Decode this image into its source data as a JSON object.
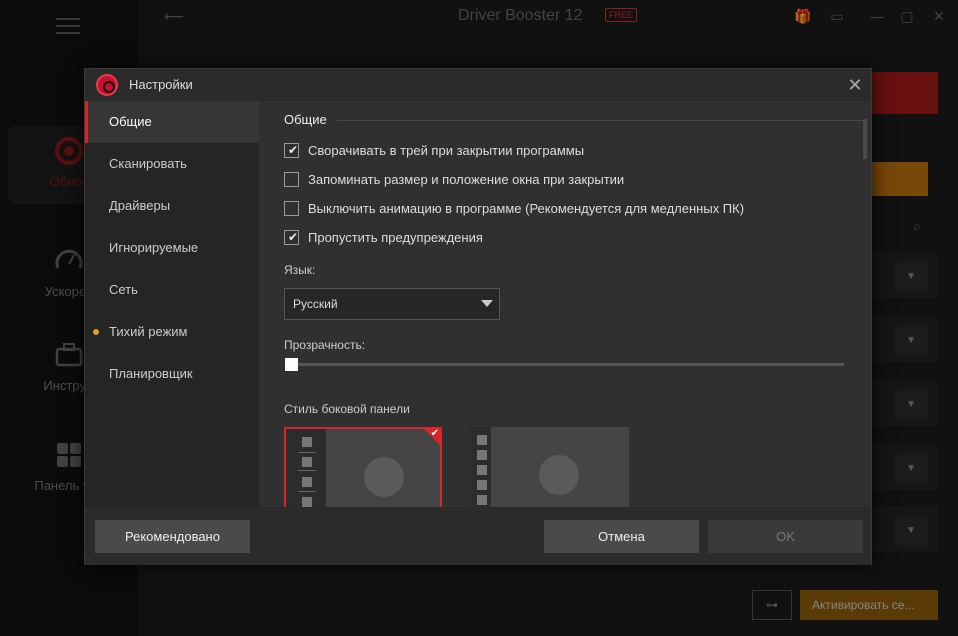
{
  "app": {
    "title": "Driver Booster 12",
    "badge": "FREE",
    "sidebar": [
      {
        "label": "Обнов",
        "icon": "update-icon"
      },
      {
        "label": "Ускорен",
        "icon": "speedometer-icon"
      },
      {
        "label": "Инструм",
        "icon": "toolbox-icon"
      },
      {
        "label": "Панель упр",
        "icon": "grid-icon"
      }
    ],
    "activate_label": "Активировать се...",
    "accent": "#d6262b",
    "warning": "#e5a023"
  },
  "dialog": {
    "title": "Настройки",
    "nav": [
      {
        "label": "Общие",
        "active": true
      },
      {
        "label": "Сканировать"
      },
      {
        "label": "Драйверы"
      },
      {
        "label": "Игнорируемые"
      },
      {
        "label": "Сеть"
      },
      {
        "label": "Тихий режим",
        "dot": true
      },
      {
        "label": "Планировщик"
      }
    ],
    "section_title": "Общие",
    "options": [
      {
        "label": "Сворачивать в трей при закрытии программы",
        "checked": true
      },
      {
        "label": "Запоминать размер и положение окна при закрытии",
        "checked": false
      },
      {
        "label": "Выключить анимацию в программе (Рекомендуется для медленных ПК)",
        "checked": false
      },
      {
        "label": "Пропустить предупреждения",
        "checked": true
      }
    ],
    "language_label": "Язык:",
    "language_value": "Русский",
    "transparency_label": "Прозрачность:",
    "transparency_value": 0,
    "sidebar_style_label": "Стиль боковой панели",
    "sidebar_style_selected": 1,
    "buttons": {
      "recommend": "Рекомендовано",
      "cancel": "Отмена",
      "ok": "OK"
    }
  }
}
